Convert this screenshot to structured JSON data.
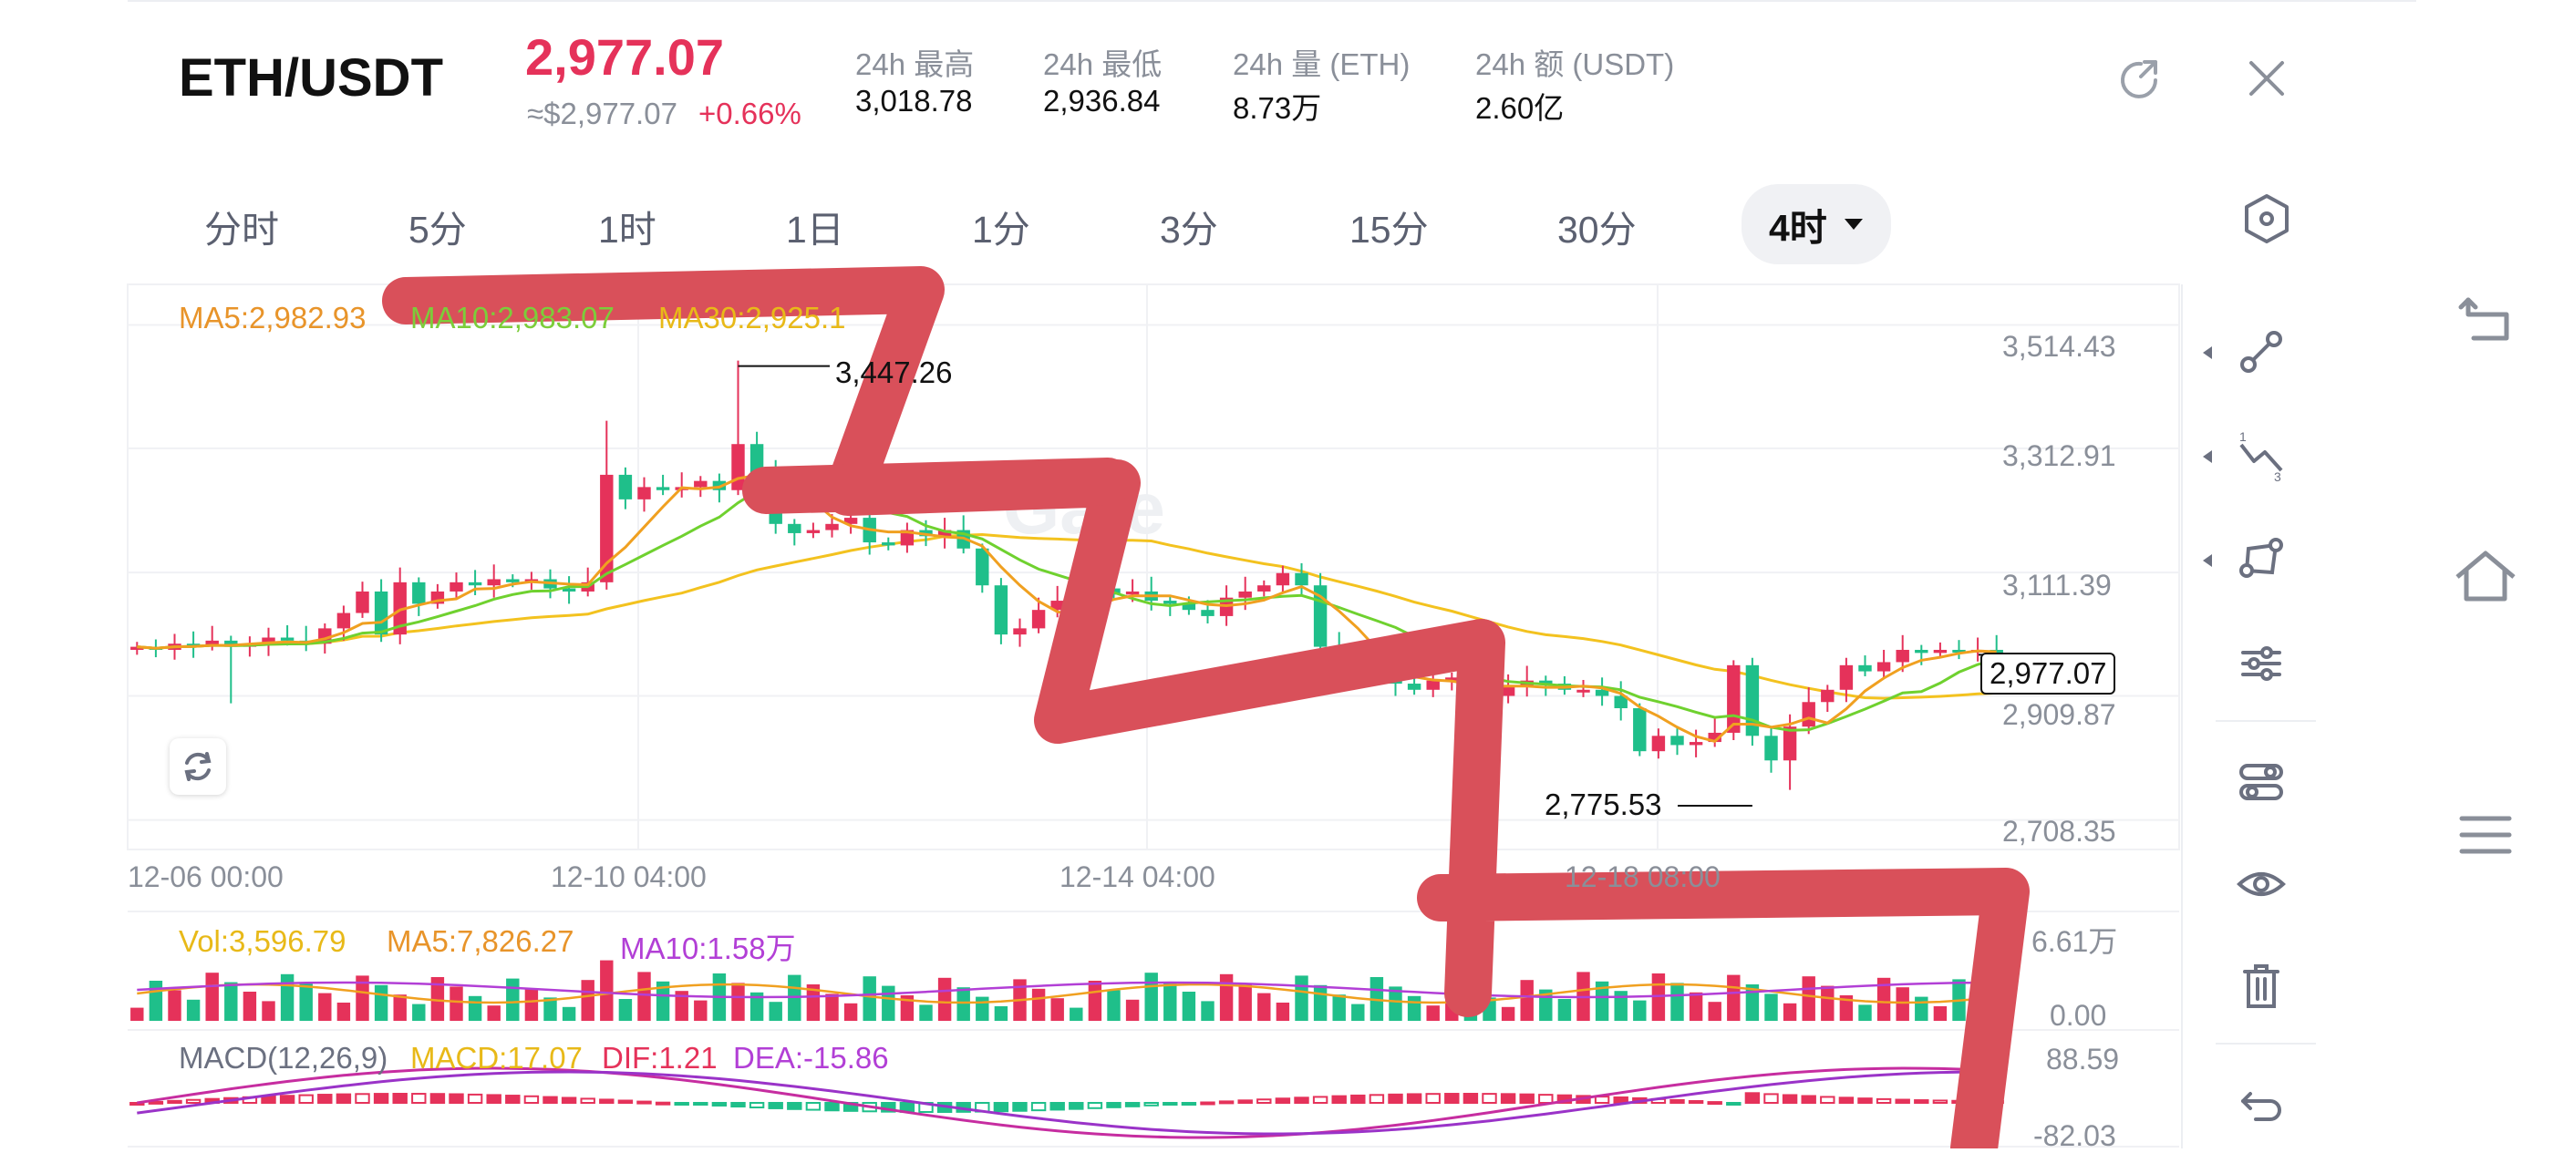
{
  "header": {
    "pair": "ETH/USDT",
    "price": "2,977.07",
    "approx_price": "≈$2,977.07",
    "change": "+0.66%",
    "stats": [
      {
        "label": "24h  最高",
        "value": "3,018.78"
      },
      {
        "label": "24h  最低",
        "value": "2,936.84"
      },
      {
        "label": "24h  量 (ETH)",
        "value": "8.73万"
      },
      {
        "label": "24h  额 (USDT)",
        "value": "2.60亿"
      }
    ]
  },
  "tabs": {
    "items": [
      "分时",
      "5分",
      "1时",
      "1日",
      "1分",
      "3分",
      "15分",
      "30分"
    ],
    "active": "4时"
  },
  "legend": {
    "ma5": "MA5:2,982.93",
    "ma10": "MA10:2,983.07",
    "ma30": "MA30:2,925.1"
  },
  "price_axis": [
    "3,514.43",
    "3,312.91",
    "3,111.39",
    "2,909.87",
    "2,708.35"
  ],
  "time_axis": [
    "12-06 00:00",
    "12-10 04:00",
    "12-14 04:00",
    "12-18 08:00"
  ],
  "annotations": {
    "high": "3,447.26",
    "low": "2,775.53",
    "last": "2,977.07"
  },
  "volume": {
    "vol": "Vol:3,596.79",
    "ma5": "MA5:7,826.27",
    "ma10": "MA10:1.58万",
    "axis_top": "6.61万",
    "axis_bottom": "0.00"
  },
  "macd": {
    "label": "MACD(12,26,9)",
    "macd": "MACD:17.07",
    "dif": "DIF:1.21",
    "dea": "DEA:-15.86",
    "axis_top": "88.59",
    "axis_bottom": "-82.03"
  },
  "colors": {
    "up": "#e5325a",
    "down": "#1fbf8a",
    "ma5": "#f0a020",
    "ma10": "#6fd12f",
    "ma30": "#f3c21f",
    "vol_ma10": "#b23fd6",
    "scribble": "#d9505a"
  }
}
